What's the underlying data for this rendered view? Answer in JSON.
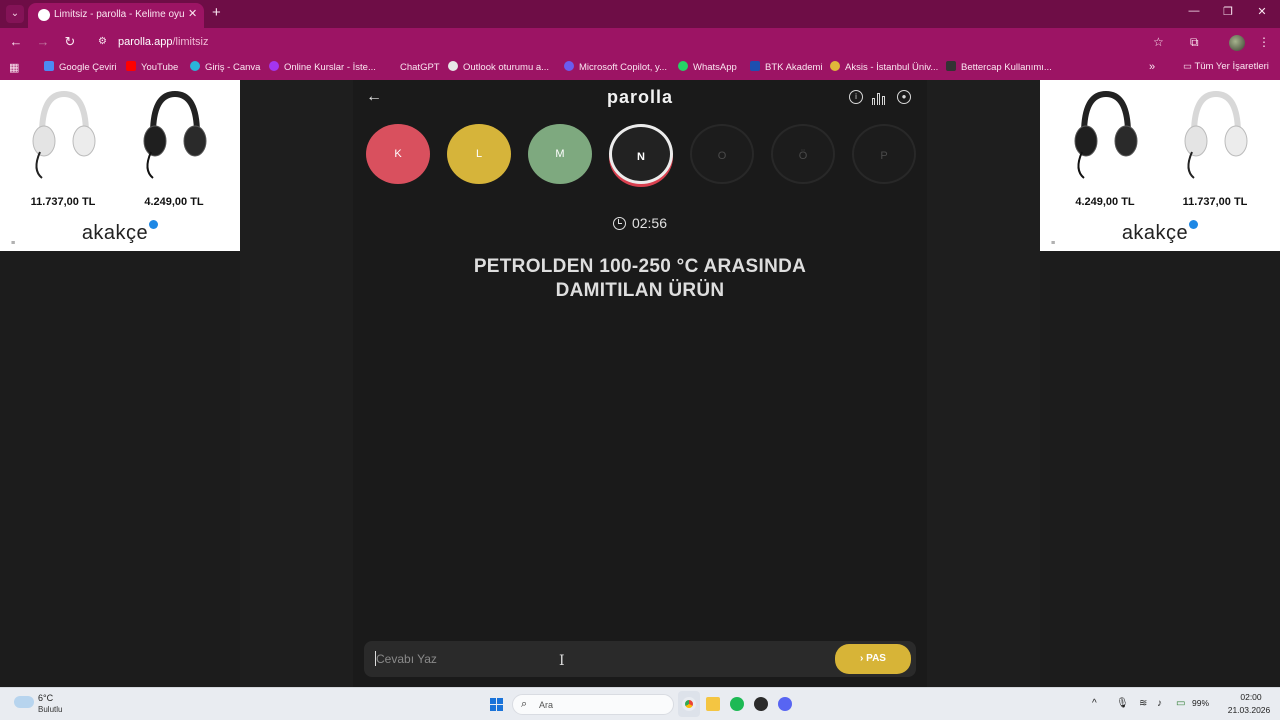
{
  "browser": {
    "tab_title": "Limitsiz - parolla - Kelime oyunu",
    "url_host": "parolla.app",
    "url_path": "/limitsiz",
    "bookmarks": [
      {
        "label": "Google Çeviri",
        "color": "#4a8af4"
      },
      {
        "label": "YouTube",
        "color": "#ff0000"
      },
      {
        "label": "Giriş - Canva",
        "color": "#2bb4d9"
      },
      {
        "label": "Online Kurslar - İste...",
        "color": "#a435f0"
      },
      {
        "label": "ChatGPT",
        "color": "#9c1464"
      },
      {
        "label": "Outlook oturumu a...",
        "color": "#e8e8e8"
      },
      {
        "label": "Microsoft Copilot, y...",
        "color": "#6a5cf0"
      },
      {
        "label": "WhatsApp",
        "color": "#25d366"
      },
      {
        "label": "BTK Akademi",
        "color": "#1d4fb0"
      },
      {
        "label": "Aksis - İstanbul Üniv...",
        "color": "#e0b83a"
      },
      {
        "label": "Bettercap Kullanımı...",
        "color": "#333333"
      }
    ],
    "all_bookmarks": "Tüm Yer İşaretleri"
  },
  "ads": {
    "left": {
      "prices": [
        "11.737,00 TL",
        "4.249,00 TL"
      ]
    },
    "right": {
      "prices": [
        "4.249,00 TL",
        "11.737,00 TL"
      ]
    },
    "brand": "akakçe"
  },
  "game": {
    "logo": "parolla",
    "letters": [
      {
        "char": "K",
        "state": "done",
        "color": "#d9505e"
      },
      {
        "char": "L",
        "state": "done",
        "color": "#d6b43a"
      },
      {
        "char": "M",
        "state": "done",
        "color": "#7ea97f"
      },
      {
        "char": "N",
        "state": "current",
        "color": "#222222"
      },
      {
        "char": "O",
        "state": "pending",
        "color": "#1c1c1c"
      },
      {
        "char": "Ö",
        "state": "pending",
        "color": "#1c1c1c"
      },
      {
        "char": "P",
        "state": "pending",
        "color": "#1c1c1c"
      }
    ],
    "timer": "02:56",
    "question_line1": "PETROLDEN 100-250 °C ARASINDA",
    "question_line2": "DAMITILAN ÜRÜN",
    "answer_placeholder": "Cevabı Yaz",
    "pas_label": "PAS"
  },
  "taskbar": {
    "weather_temp": "6°C",
    "weather_desc": "Bulutlu",
    "search_placeholder": "Ara",
    "battery": "99%",
    "time": "02:00",
    "date": "21.03.2026"
  }
}
